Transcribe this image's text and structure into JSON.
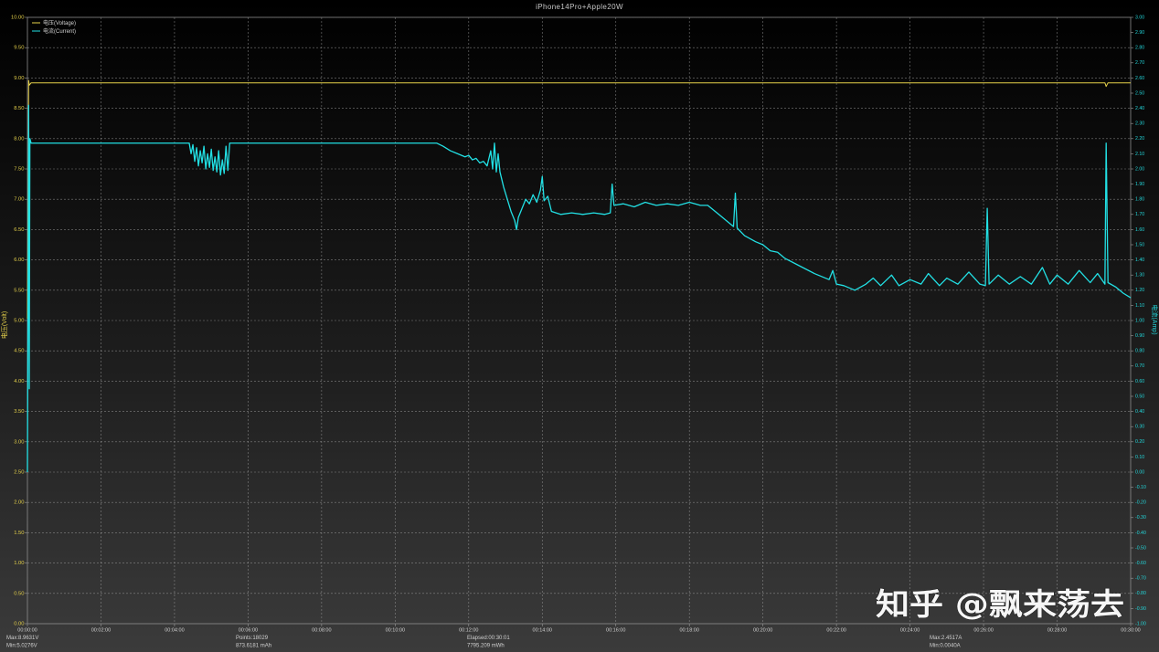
{
  "stats": {
    "voltage_max": "Max:8.9631V",
    "voltage_min": "Min:5.0276V",
    "points": "Points:18029",
    "capacity": "873.6181 mAh",
    "elapsed": "Elapsed:00:30:01",
    "energy": "7795.209 mWh",
    "current_max": "Max:2.4517A",
    "current_min": "Min:0.0040A"
  },
  "watermark": "知乎 @飘来荡去",
  "chart_data": {
    "type": "line",
    "title": "iPhone14Pro+Apple20W",
    "grid": true,
    "legend_position": "top-left",
    "x_axis": {
      "range": [
        "00:00:00",
        "00:30:00"
      ],
      "ticks": [
        "00:00:00",
        "00:02:00",
        "00:04:00",
        "00:06:00",
        "00:08:00",
        "00:10:00",
        "00:12:00",
        "00:14:00",
        "00:16:00",
        "00:18:00",
        "00:20:00",
        "00:22:00",
        "00:24:00",
        "00:26:00",
        "00:28:00",
        "00:30:00"
      ]
    },
    "y_left": {
      "label": "电压(Volt)",
      "color": "#e3cf4a",
      "range": [
        0,
        10
      ],
      "ticks": [
        "0.00",
        "0.50",
        "1.00",
        "1.50",
        "2.00",
        "2.50",
        "3.00",
        "3.50",
        "4.00",
        "4.50",
        "5.00",
        "5.50",
        "6.00",
        "6.50",
        "7.00",
        "7.50",
        "8.00",
        "8.50",
        "9.00",
        "9.50",
        "10.00"
      ]
    },
    "y_right": {
      "label": "电流(Amp)",
      "color": "#22d6da",
      "range": [
        -1,
        3
      ],
      "ticks": [
        "-1.00",
        "-0.90",
        "-0.80",
        "-0.70",
        "-0.60",
        "-0.50",
        "-0.40",
        "-0.30",
        "-0.20",
        "-0.10",
        "0.00",
        "0.10",
        "0.20",
        "0.30",
        "0.40",
        "0.50",
        "0.60",
        "0.70",
        "0.80",
        "0.90",
        "1.00",
        "1.10",
        "1.20",
        "1.30",
        "1.40",
        "1.50",
        "1.60",
        "1.70",
        "1.80",
        "1.90",
        "2.00",
        "2.10",
        "2.20",
        "2.30",
        "2.40",
        "2.50",
        "2.60",
        "2.70",
        "2.80",
        "2.90",
        "3.00"
      ]
    },
    "series": [
      {
        "name": "电压(Voltage)",
        "y_axis": "left",
        "color": "#e6d24a",
        "points": [
          [
            "00:00:00",
            5.03
          ],
          [
            "00:00:02",
            8.96
          ],
          [
            "00:00:03",
            8.88
          ],
          [
            "00:00:06",
            8.92
          ],
          [
            "00:10:00",
            8.92
          ],
          [
            "00:20:00",
            8.92
          ],
          [
            "00:29:18",
            8.92
          ],
          [
            "00:29:20",
            8.86
          ],
          [
            "00:29:23",
            8.92
          ],
          [
            "00:30:00",
            8.92
          ]
        ]
      },
      {
        "name": "电流(Current)",
        "y_axis": "right",
        "color": "#22e0e4",
        "points": [
          [
            "00:00:00",
            0.0
          ],
          [
            "00:00:02",
            2.42
          ],
          [
            "00:00:03",
            0.55
          ],
          [
            "00:00:04",
            2.2
          ],
          [
            "00:00:06",
            2.17
          ],
          [
            "00:02:00",
            2.17
          ],
          [
            "00:04:24",
            2.17
          ],
          [
            "00:04:27",
            2.1
          ],
          [
            "00:04:30",
            2.16
          ],
          [
            "00:04:33",
            2.05
          ],
          [
            "00:04:36",
            2.14
          ],
          [
            "00:04:39",
            2.02
          ],
          [
            "00:04:42",
            2.12
          ],
          [
            "00:04:45",
            2.04
          ],
          [
            "00:04:48",
            2.15
          ],
          [
            "00:04:51",
            2.0
          ],
          [
            "00:04:54",
            2.1
          ],
          [
            "00:04:57",
            2.01
          ],
          [
            "00:05:00",
            2.13
          ],
          [
            "00:05:03",
            1.99
          ],
          [
            "00:05:06",
            2.08
          ],
          [
            "00:05:09",
            1.98
          ],
          [
            "00:05:12",
            2.12
          ],
          [
            "00:05:15",
            1.96
          ],
          [
            "00:05:18",
            2.06
          ],
          [
            "00:05:21",
            1.97
          ],
          [
            "00:05:24",
            2.15
          ],
          [
            "00:05:27",
            1.99
          ],
          [
            "00:05:30",
            2.17
          ],
          [
            "00:08:00",
            2.17
          ],
          [
            "00:11:08",
            2.17
          ],
          [
            "00:11:18",
            2.15
          ],
          [
            "00:11:30",
            2.12
          ],
          [
            "00:11:42",
            2.1
          ],
          [
            "00:11:54",
            2.08
          ],
          [
            "00:12:00",
            2.09
          ],
          [
            "00:12:06",
            2.06
          ],
          [
            "00:12:12",
            2.07
          ],
          [
            "00:12:18",
            2.04
          ],
          [
            "00:12:24",
            2.05
          ],
          [
            "00:12:30",
            2.02
          ],
          [
            "00:12:36",
            2.12
          ],
          [
            "00:12:39",
            2.0
          ],
          [
            "00:12:42",
            2.17
          ],
          [
            "00:12:45",
            1.98
          ],
          [
            "00:12:48",
            2.1
          ],
          [
            "00:12:51",
            1.98
          ],
          [
            "00:12:57",
            1.88
          ],
          [
            "00:13:03",
            1.8
          ],
          [
            "00:13:09",
            1.72
          ],
          [
            "00:13:15",
            1.66
          ],
          [
            "00:13:18",
            1.6
          ],
          [
            "00:13:21",
            1.68
          ],
          [
            "00:13:27",
            1.74
          ],
          [
            "00:13:33",
            1.8
          ],
          [
            "00:13:39",
            1.77
          ],
          [
            "00:13:45",
            1.83
          ],
          [
            "00:13:51",
            1.78
          ],
          [
            "00:13:57",
            1.86
          ],
          [
            "00:14:00",
            1.95
          ],
          [
            "00:14:03",
            1.79
          ],
          [
            "00:14:09",
            1.82
          ],
          [
            "00:14:15",
            1.72
          ],
          [
            "00:14:30",
            1.7
          ],
          [
            "00:14:48",
            1.71
          ],
          [
            "00:15:06",
            1.7
          ],
          [
            "00:15:24",
            1.71
          ],
          [
            "00:15:42",
            1.7
          ],
          [
            "00:15:51",
            1.71
          ],
          [
            "00:15:54",
            1.9
          ],
          [
            "00:15:57",
            1.76
          ],
          [
            "00:16:12",
            1.77
          ],
          [
            "00:16:30",
            1.75
          ],
          [
            "00:16:48",
            1.78
          ],
          [
            "00:17:06",
            1.76
          ],
          [
            "00:17:24",
            1.77
          ],
          [
            "00:17:42",
            1.76
          ],
          [
            "00:18:00",
            1.78
          ],
          [
            "00:18:18",
            1.76
          ],
          [
            "00:18:30",
            1.76
          ],
          [
            "00:18:48",
            1.7
          ],
          [
            "00:19:12",
            1.62
          ],
          [
            "00:19:15",
            1.84
          ],
          [
            "00:19:18",
            1.61
          ],
          [
            "00:19:30",
            1.56
          ],
          [
            "00:19:48",
            1.52
          ],
          [
            "00:20:00",
            1.5
          ],
          [
            "00:20:12",
            1.46
          ],
          [
            "00:20:24",
            1.45
          ],
          [
            "00:20:36",
            1.41
          ],
          [
            "00:21:00",
            1.36
          ],
          [
            "00:21:24",
            1.31
          ],
          [
            "00:21:48",
            1.27
          ],
          [
            "00:21:54",
            1.33
          ],
          [
            "00:22:00",
            1.24
          ],
          [
            "00:22:12",
            1.23
          ],
          [
            "00:22:30",
            1.2
          ],
          [
            "00:22:48",
            1.24
          ],
          [
            "00:23:00",
            1.28
          ],
          [
            "00:23:12",
            1.23
          ],
          [
            "00:23:30",
            1.3
          ],
          [
            "00:23:42",
            1.23
          ],
          [
            "00:24:00",
            1.27
          ],
          [
            "00:24:18",
            1.24
          ],
          [
            "00:24:30",
            1.31
          ],
          [
            "00:24:48",
            1.23
          ],
          [
            "00:25:00",
            1.28
          ],
          [
            "00:25:18",
            1.24
          ],
          [
            "00:25:36",
            1.32
          ],
          [
            "00:25:54",
            1.24
          ],
          [
            "00:26:03",
            1.23
          ],
          [
            "00:26:06",
            1.74
          ],
          [
            "00:26:09",
            1.24
          ],
          [
            "00:26:24",
            1.3
          ],
          [
            "00:26:42",
            1.24
          ],
          [
            "00:27:00",
            1.29
          ],
          [
            "00:27:18",
            1.24
          ],
          [
            "00:27:36",
            1.35
          ],
          [
            "00:27:48",
            1.24
          ],
          [
            "00:28:00",
            1.3
          ],
          [
            "00:28:18",
            1.24
          ],
          [
            "00:28:36",
            1.33
          ],
          [
            "00:28:54",
            1.25
          ],
          [
            "00:29:06",
            1.31
          ],
          [
            "00:29:18",
            1.24
          ],
          [
            "00:29:20",
            2.17
          ],
          [
            "00:29:23",
            1.25
          ],
          [
            "00:29:36",
            1.22
          ],
          [
            "00:29:48",
            1.18
          ],
          [
            "00:30:00",
            1.15
          ]
        ]
      }
    ]
  }
}
